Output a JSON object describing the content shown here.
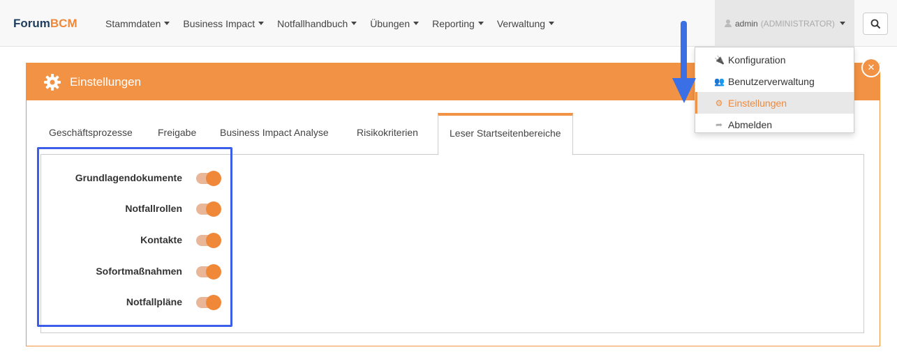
{
  "brand": {
    "part1": "Forum",
    "part2": "BCM"
  },
  "nav": {
    "items": [
      {
        "label": "Stammdaten"
      },
      {
        "label": "Business Impact"
      },
      {
        "label": "Notfallhandbuch"
      },
      {
        "label": "Übungen"
      },
      {
        "label": "Reporting"
      },
      {
        "label": "Verwaltung"
      }
    ],
    "user": {
      "name": "admin",
      "role": "(ADMINISTRATOR)"
    }
  },
  "panel": {
    "title": "Einstellungen",
    "close_icon": "close-icon",
    "tabs": [
      {
        "label": "Geschäftsprozesse"
      },
      {
        "label": "Freigabe"
      },
      {
        "label": "Business Impact Analyse"
      },
      {
        "label": "Risikokriterien"
      },
      {
        "label": "Leser Startseitenbereiche",
        "active": true
      }
    ],
    "toggles": [
      {
        "label": "Grundlagendokumente",
        "on": true
      },
      {
        "label": "Notfallrollen",
        "on": true
      },
      {
        "label": "Kontakte",
        "on": true
      },
      {
        "label": "Sofortmaßnahmen",
        "on": true
      },
      {
        "label": "Notfallpläne",
        "on": true
      }
    ]
  },
  "dropdown": {
    "items": [
      {
        "label": "Konfiguration",
        "icon": "plug-icon"
      },
      {
        "label": "Benutzerverwaltung",
        "icon": "users-icon"
      },
      {
        "label": "Einstellungen",
        "icon": "gear-icon",
        "active": true
      },
      {
        "label": "Abmelden",
        "icon": "sign-out-icon"
      }
    ]
  },
  "colors": {
    "accent": "#f29244",
    "highlight": "#3b5de7",
    "arrow": "#3b6fe6"
  }
}
